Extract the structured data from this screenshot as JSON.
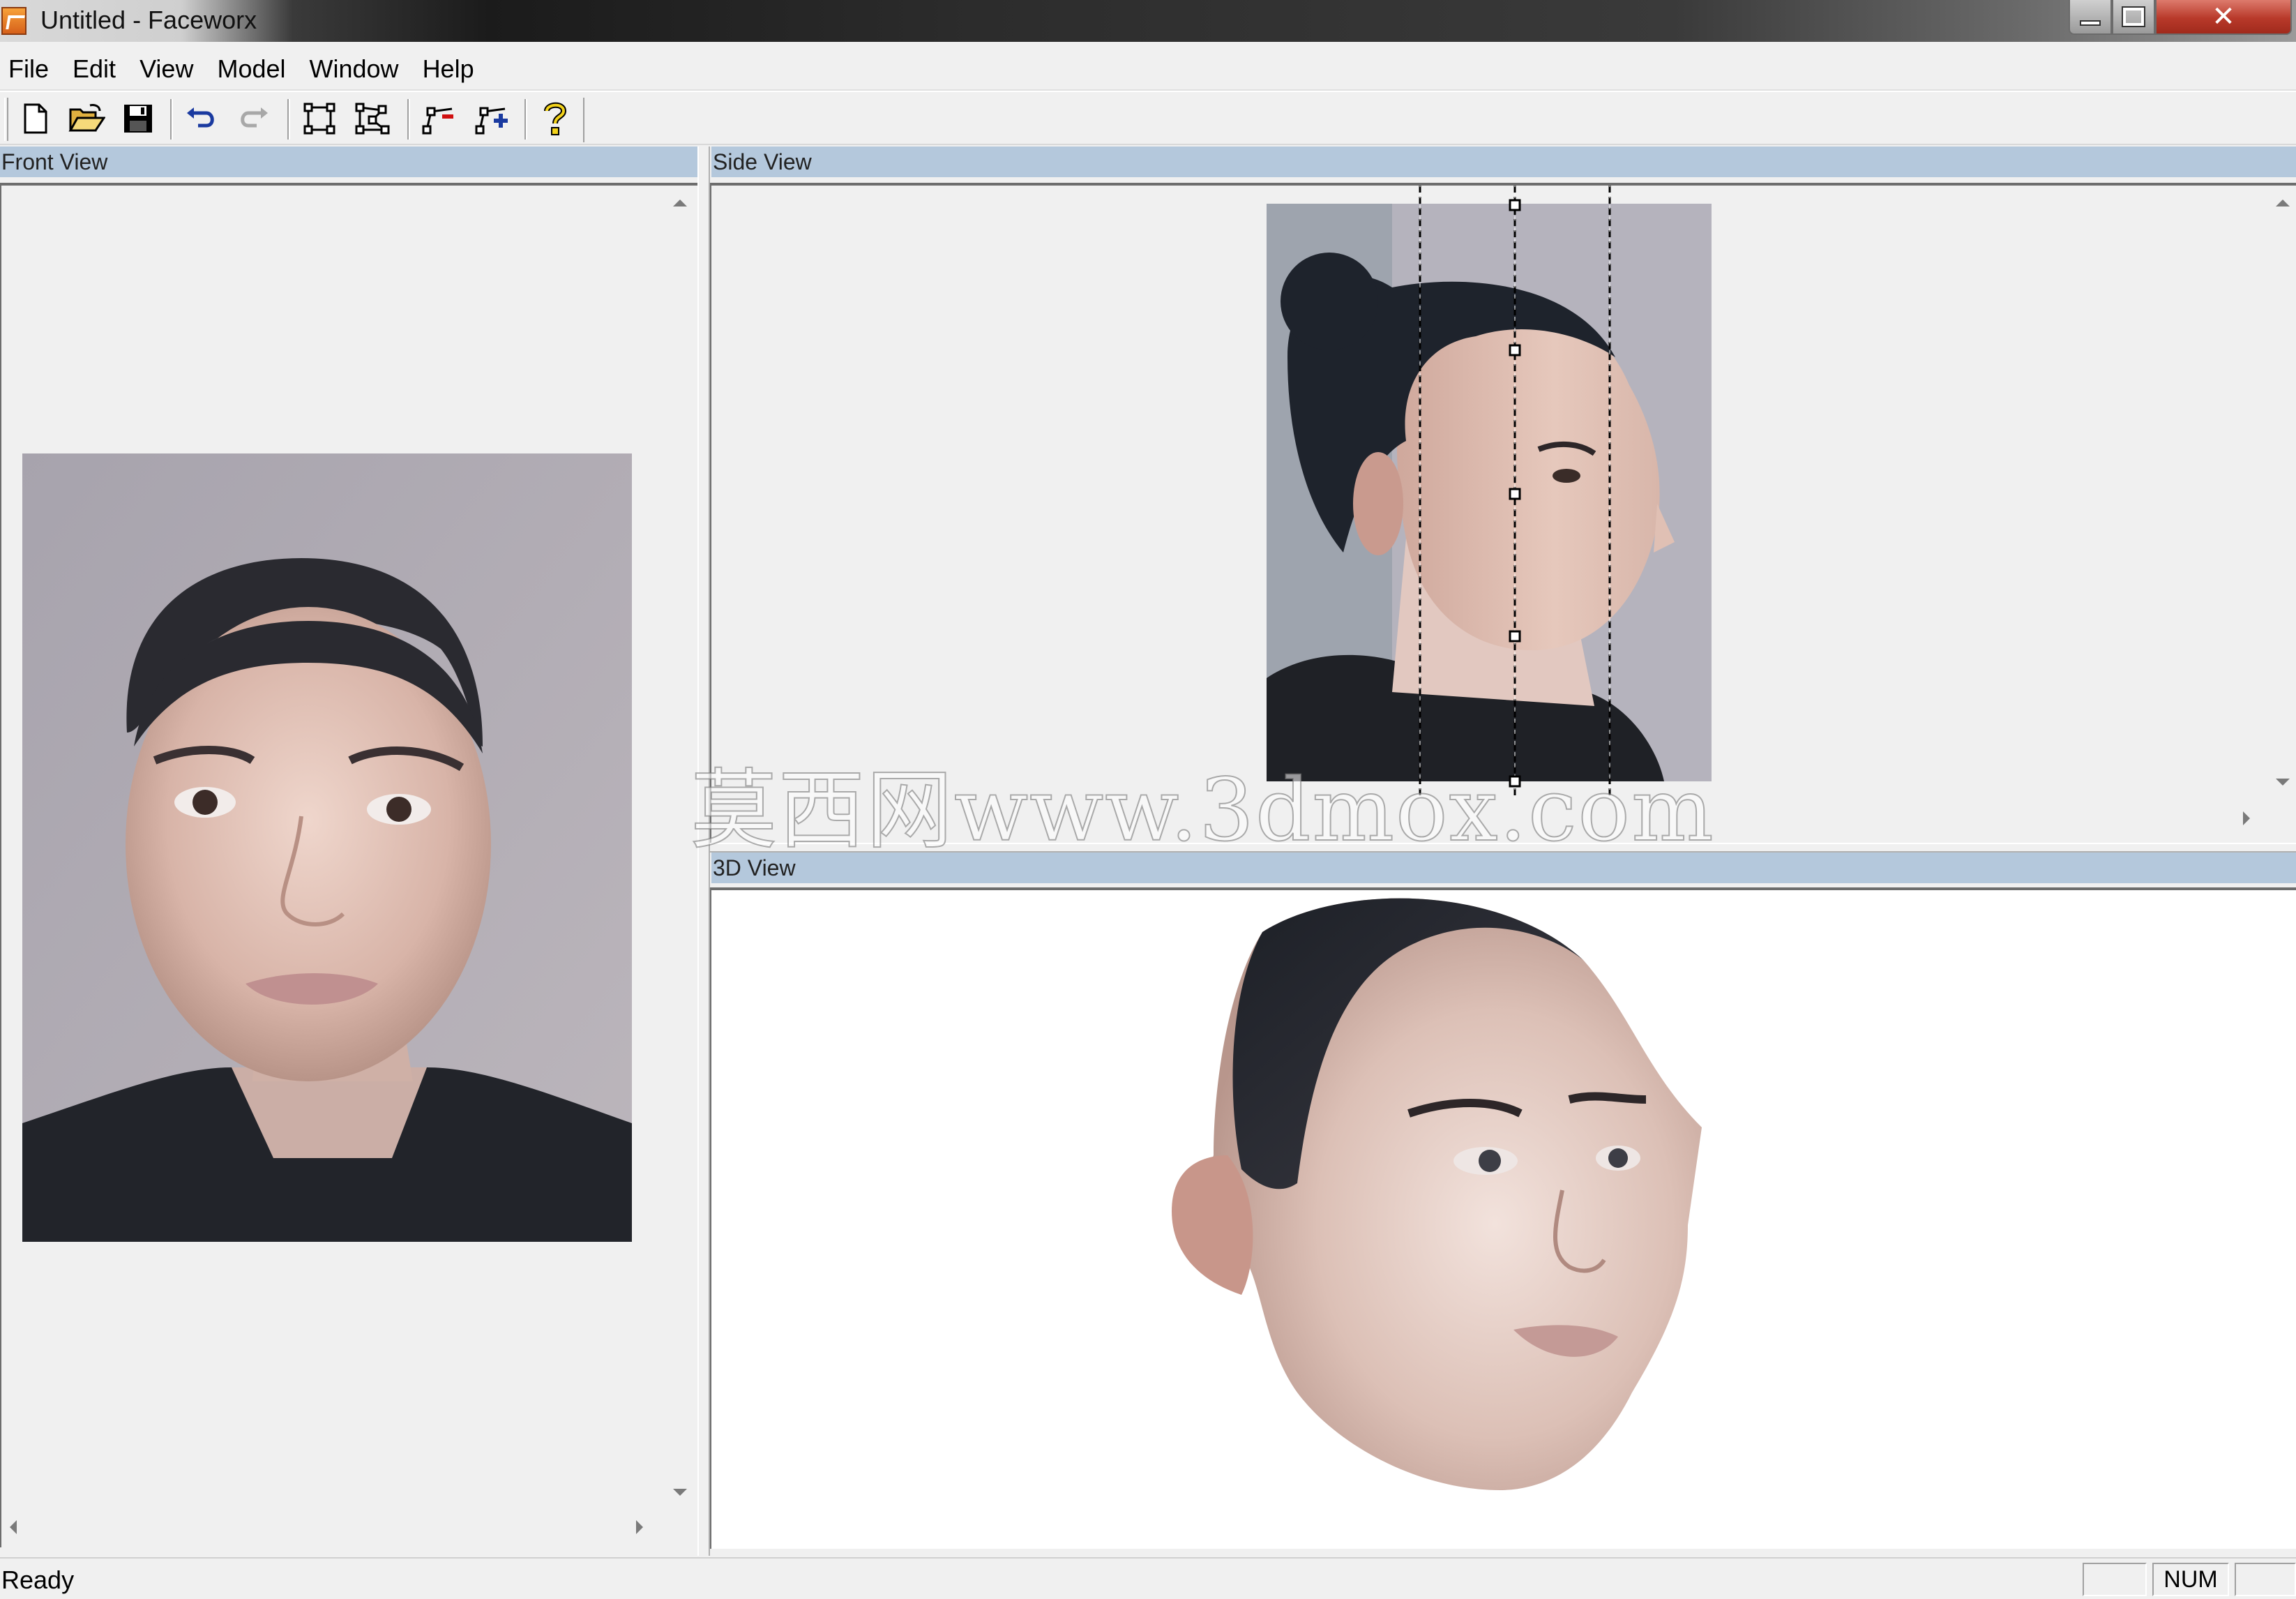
{
  "window": {
    "title": "Untitled - Faceworx",
    "close_glyph": "✕"
  },
  "menu": {
    "items": [
      {
        "label": "File"
      },
      {
        "label": "Edit"
      },
      {
        "label": "View"
      },
      {
        "label": "Model"
      },
      {
        "label": "Window"
      },
      {
        "label": "Help"
      }
    ]
  },
  "toolbar": {
    "buttons": [
      {
        "icon": "new-document-icon"
      },
      {
        "icon": "open-folder-icon"
      },
      {
        "icon": "save-disk-icon"
      },
      {
        "icon": "undo-icon"
      },
      {
        "icon": "redo-icon",
        "enabled": false
      },
      {
        "icon": "select-rectangle-icon"
      },
      {
        "icon": "select-points-icon"
      },
      {
        "icon": "add-point-icon"
      },
      {
        "icon": "add-point-plus-icon"
      },
      {
        "icon": "help-question-icon"
      }
    ]
  },
  "panes": {
    "front": {
      "title": "Front View"
    },
    "side": {
      "title": "Side View"
    },
    "view3d": {
      "title": "3D View"
    }
  },
  "watermark": "莫西网www.3dmox.com",
  "status": {
    "text": "Ready",
    "num": "NUM"
  },
  "colors": {
    "pane_header": "#b4c8dc",
    "close_button": "#b8392a",
    "skin": "#e8c9bd",
    "hair": "#2a2a30"
  }
}
